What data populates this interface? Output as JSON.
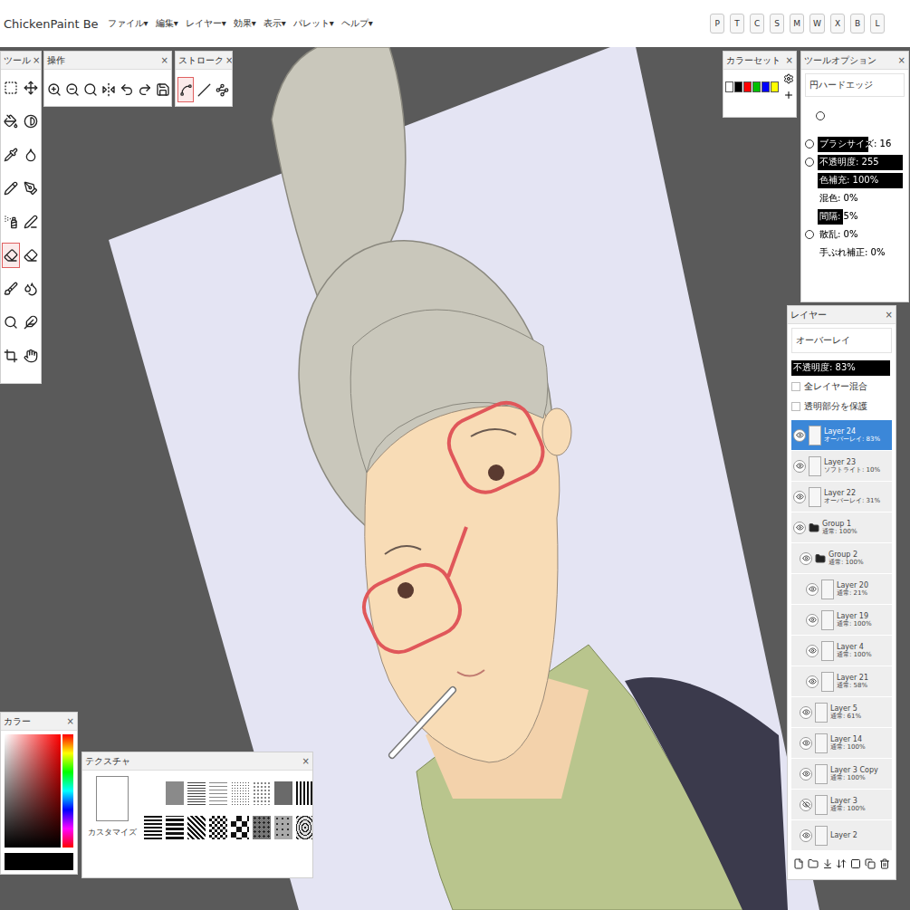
{
  "app": {
    "title": "ChickenPaint Be"
  },
  "menus": [
    "ファイル▾",
    "編集▾",
    "レイヤー▾",
    "効果▾",
    "表示▾",
    "パレット▾",
    "ヘルプ▾"
  ],
  "palette_buttons": [
    "P",
    "T",
    "C",
    "S",
    "M",
    "W",
    "X",
    "B",
    "L"
  ],
  "tools_panel": {
    "title": "ツール",
    "close": "×",
    "tools": [
      {
        "selected": false
      },
      {
        "selected": false
      },
      {
        "selected": false
      },
      {
        "selected": false
      },
      {
        "selected": false
      },
      {
        "selected": false
      },
      {
        "selected": false
      },
      {
        "selected": false
      },
      {
        "selected": false
      },
      {
        "selected": false
      },
      {
        "selected": true
      },
      {
        "selected": false
      },
      {
        "selected": false
      },
      {
        "selected": false
      },
      {
        "selected": false
      },
      {
        "selected": false
      },
      {
        "selected": false
      },
      {
        "selected": false
      }
    ]
  },
  "operations_panel": {
    "title": "操作",
    "close": "×"
  },
  "stroke_panel": {
    "title": "ストローク",
    "close": "×",
    "strokes": [
      {
        "selected": true
      },
      {
        "selected": false
      },
      {
        "selected": false
      }
    ]
  },
  "color_set_panel": {
    "title": "カラーセット",
    "close": "×",
    "swatches": [
      {
        "color": "#ffffff"
      },
      {
        "color": "#000000"
      },
      {
        "color": "#ff0000"
      },
      {
        "color": "#00c000"
      },
      {
        "color": "#0000ff"
      },
      {
        "color": "#ffff00"
      }
    ]
  },
  "tool_options_panel": {
    "title": "ツールオプション",
    "close": "×",
    "brush": "円ハードエッジ",
    "rows": [
      {
        "label": "ブラシサイズ: 16",
        "kind": "toggle-slider",
        "pressure": false,
        "level": 0.6
      },
      {
        "label": "不透明度: 255",
        "kind": "toggle-slider",
        "pressure": false,
        "level": 1
      },
      {
        "label": "色補充: 100%",
        "kind": "slider",
        "level": 1
      },
      {
        "label": "混色: 0%",
        "kind": "slider",
        "level": 0
      },
      {
        "label": "間隔: 5%",
        "kind": "slider",
        "level": 0.3
      },
      {
        "label": "散乱: 0%",
        "kind": "toggle-slider",
        "pressure": false,
        "level": 0
      },
      {
        "label": "手ぶれ補正: 0%",
        "kind": "slider",
        "level": 0
      }
    ]
  },
  "layers_panel": {
    "title": "レイヤー",
    "close": "×",
    "blend_mode": "オーバーレイ",
    "opacity": {
      "label": "不透明度: 83%",
      "level": 1
    },
    "checkboxes": [
      {
        "label": "全レイヤー混合",
        "checked": false
      },
      {
        "label": "透明部分を保護",
        "checked": false
      }
    ],
    "layers": [
      {
        "name": "Layer 24",
        "mode": "オーバーレイ: 83%",
        "kind": "layer",
        "depth": 0,
        "visible": true,
        "selected": true
      },
      {
        "name": "Layer 23",
        "mode": "ソフトライト: 10%",
        "kind": "layer",
        "depth": 0,
        "visible": true,
        "selected": false
      },
      {
        "name": "Layer 22",
        "mode": "オーバーレイ: 31%",
        "kind": "layer",
        "depth": 0,
        "visible": true,
        "selected": false
      },
      {
        "name": "Group 1",
        "mode": "通常: 100%",
        "kind": "group",
        "depth": 0,
        "visible": true,
        "selected": false
      },
      {
        "name": "Group 2",
        "mode": "通常: 100%",
        "kind": "group",
        "depth": 1,
        "visible": true,
        "selected": false
      },
      {
        "name": "Layer 20",
        "mode": "通常: 21%",
        "kind": "layer",
        "depth": 2,
        "visible": true,
        "selected": false
      },
      {
        "name": "Layer 19",
        "mode": "通常: 100%",
        "kind": "layer",
        "depth": 2,
        "visible": true,
        "selected": false
      },
      {
        "name": "Layer 4",
        "mode": "通常: 100%",
        "kind": "layer",
        "depth": 2,
        "visible": true,
        "selected": false
      },
      {
        "name": "Layer 21",
        "mode": "通常: 58%",
        "kind": "layer",
        "depth": 2,
        "visible": true,
        "selected": false
      },
      {
        "name": "Layer 5",
        "mode": "通常: 61%",
        "kind": "layer",
        "depth": 1,
        "visible": true,
        "selected": false
      },
      {
        "name": "Layer 14",
        "mode": "通常: 100%",
        "kind": "layer",
        "depth": 1,
        "visible": true,
        "selected": false
      },
      {
        "name": "Layer 3 Copy",
        "mode": "通常: 100%",
        "kind": "layer",
        "depth": 1,
        "visible": true,
        "selected": false
      },
      {
        "name": "Layer 3",
        "mode": "通常: 100%",
        "kind": "layer",
        "depth": 1,
        "visible": false,
        "selected": false
      },
      {
        "name": "Layer 2",
        "kind": "layer",
        "depth": 1,
        "visible": true,
        "selected": false
      }
    ]
  },
  "color_panel": {
    "title": "カラー",
    "close": "×"
  },
  "texture_panel": {
    "title": "テクスチャ",
    "close": "×",
    "custom_label": "カスタマイズ"
  }
}
